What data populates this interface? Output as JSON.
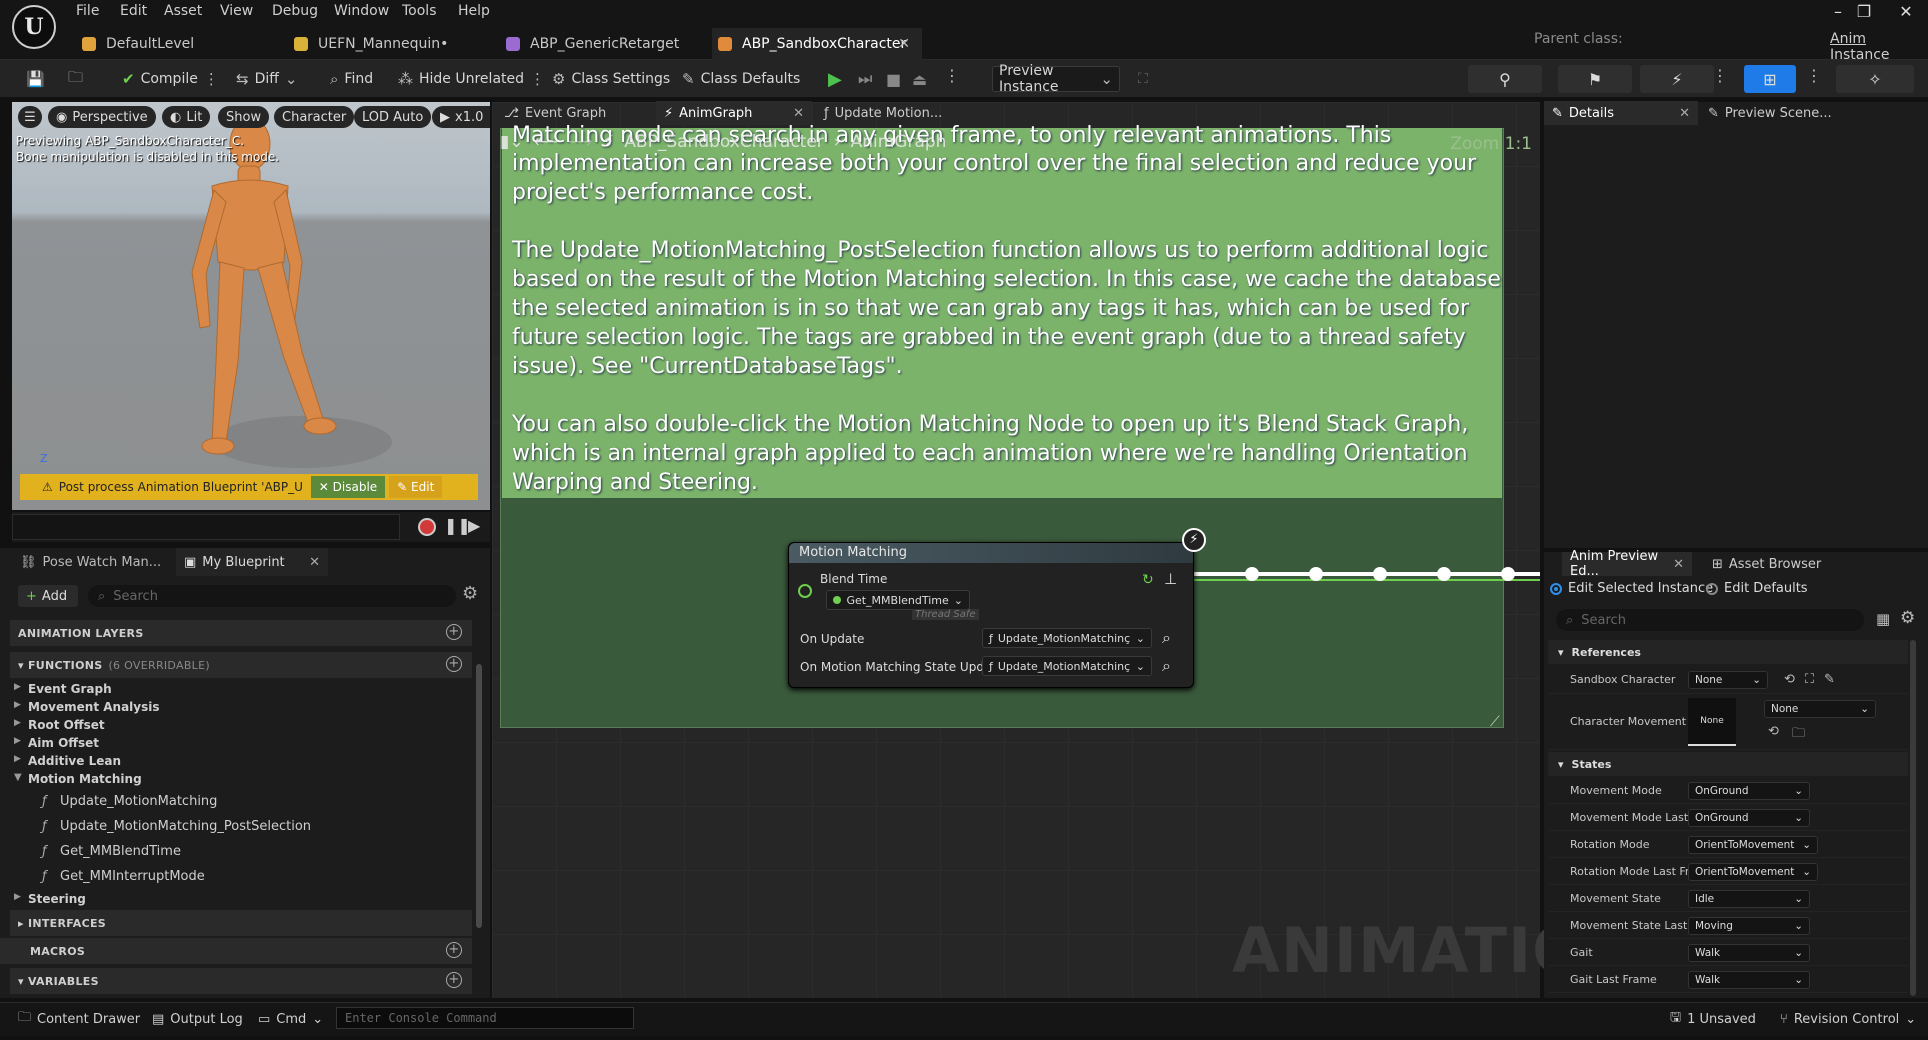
{
  "menu": [
    "File",
    "Edit",
    "Asset",
    "View",
    "Debug",
    "Window",
    "Tools",
    "Help"
  ],
  "parent_class": {
    "label": "Parent class:",
    "value": "Anim Instance"
  },
  "tabs": [
    {
      "label": "DefaultLevel",
      "icon_color": "#e0a23c"
    },
    {
      "label": "UEFN_Mannequin•",
      "icon_color": "#d9b23a"
    },
    {
      "label": "ABP_GenericRetarget",
      "icon_color": "#9a6bd0"
    },
    {
      "label": "ABP_SandboxCharacter",
      "icon_color": "#e08a3c",
      "active": true
    }
  ],
  "toolbar": {
    "compile": "Compile",
    "diff": "Diff",
    "find": "Find",
    "hide_unrelated": "Hide Unrelated",
    "class_settings": "Class Settings",
    "class_defaults": "Class Defaults",
    "preview_instance": "Preview Instance"
  },
  "viewport": {
    "buttons": [
      "Perspective",
      "Lit",
      "Show",
      "Character",
      "LOD Auto",
      "x1.0"
    ],
    "note_line1": "Previewing ABP_SandboxCharacter_C.",
    "note_line2": "Bone manipulation is disabled in this mode.",
    "warning": "Post process Animation Blueprint 'ABP_U",
    "disable": "Disable",
    "edit": "Edit"
  },
  "left_panel": {
    "tabs": [
      "Pose Watch Man...",
      "My Blueprint"
    ],
    "add": "Add",
    "search_placeholder": "Search",
    "animation_layers": "ANIMATION LAYERS",
    "functions": "FUNCTIONS",
    "functions_count": "(6 OVERRIDABLE)",
    "function_items": [
      "Event Graph",
      "Movement Analysis",
      "Root Offset",
      "Aim Offset",
      "Additive Lean",
      "Motion Matching"
    ],
    "motion_matching_children": [
      "Update_MotionMatching",
      "Update_MotionMatching_PostSelection",
      "Get_MMBlendTime",
      "Get_MMInterruptMode"
    ],
    "steering": "Steering",
    "interfaces": "INTERFACES",
    "macros": "MACROS",
    "variables": "VARIABLES"
  },
  "graph": {
    "tabs": [
      "Event Graph",
      "AnimGraph",
      "Update Motion..."
    ],
    "breadcrumb": [
      "ABP_SandboxCharacter",
      "AnimGraph"
    ],
    "zoom": "Zoom 1:1",
    "comment_lines": [
      "Matching node can search in any given frame, to only relevant animations. This",
      "implementation can increase both your control over the final selection and reduce your",
      "project's performance cost.",
      "",
      "The Update_MotionMatching_PostSelection function allows us to perform additional logic",
      "based on the result of the Motion Matching selection. In this case, we cache the database",
      "the selected animation is in so that we can grab any tags it has, which can be used for",
      "future selection logic. The tags are grabbed in the event graph (due to a thread safety",
      "issue). See \"CurrentDatabaseTags\".",
      "",
      "You can also double-click the Motion Matching Node to open up it's Blend Stack Graph,",
      "which is an internal graph applied to each animation where we're handling Orientation",
      "Warping and Steering."
    ],
    "node": {
      "title": "Motion Matching",
      "blend_time": "Blend Time",
      "blend_fn": "Get_MMBlendTime",
      "thread_safe": "Thread Safe",
      "on_update": "On Update",
      "on_update_fn": "Update_MotionMatchinç",
      "on_state": "On Motion Matching State Updated",
      "on_state_fn": "Update_MotionMatchinç"
    },
    "watermark": "ANIMATION"
  },
  "right_panel": {
    "top_tabs": [
      "Details",
      "Preview Scene..."
    ],
    "bottom_tabs": [
      "Anim Preview Ed...",
      "Asset Browser"
    ],
    "edit_selected": "Edit Selected Instance",
    "edit_defaults": "Edit Defaults",
    "search_placeholder": "Search",
    "references": "References",
    "sandbox_character": {
      "label": "Sandbox Character",
      "value": "None"
    },
    "character_movement": {
      "label": "Character Movement",
      "thumb": "None",
      "value": "None"
    },
    "states": "States",
    "state_rows": [
      {
        "label": "Movement Mode",
        "value": "OnGround"
      },
      {
        "label": "Movement Mode Last...",
        "value": "OnGround"
      },
      {
        "label": "Rotation Mode",
        "value": "OrientToMovement"
      },
      {
        "label": "Rotation Mode Last Fr...",
        "value": "OrientToMovement"
      },
      {
        "label": "Movement State",
        "value": "Idle"
      },
      {
        "label": "Movement State Last...",
        "value": "Moving"
      },
      {
        "label": "Gait",
        "value": "Walk"
      },
      {
        "label": "Gait Last Frame",
        "value": "Walk"
      }
    ]
  },
  "status": {
    "content_drawer": "Content Drawer",
    "output_log": "Output Log",
    "cmd": "Cmd",
    "console_placeholder": "Enter Console Command",
    "unsaved": "1 Unsaved",
    "revision_control": "Revision Control"
  },
  "colors": {
    "comment_green": "#7cb36b",
    "accent_blue": "#1e7be8",
    "play_green": "#4ec24e",
    "warning_yellow": "#e2b21e"
  }
}
